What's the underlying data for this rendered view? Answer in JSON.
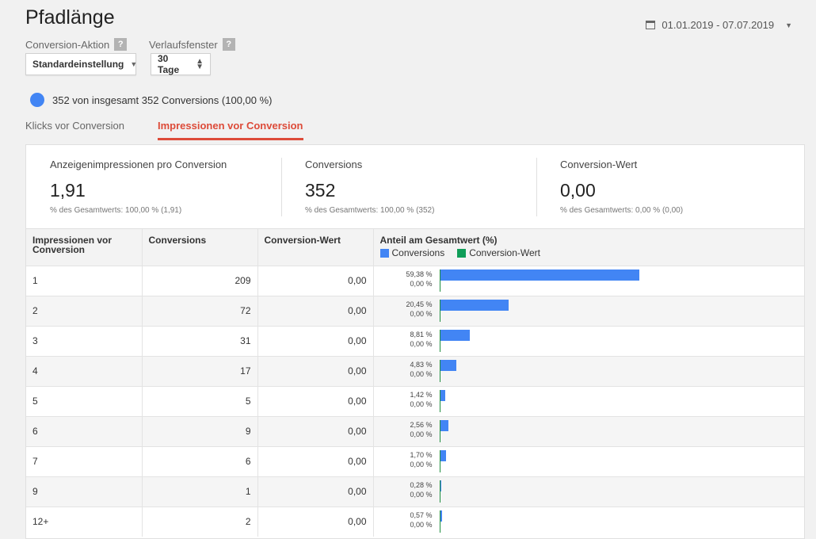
{
  "header": {
    "title": "Pfadlänge",
    "date_range": "01.01.2019 - 07.07.2019"
  },
  "filters": {
    "conversion_action_label": "Conversion-Aktion",
    "conversion_action_value": "Standardeinstellung",
    "lookback_label": "Verlaufsfenster",
    "lookback_value": "30 Tage",
    "help_glyph": "?"
  },
  "segment": {
    "text": "352 von insgesamt 352 Conversions (100,00 %)",
    "color": "#4285f4"
  },
  "tabs": [
    {
      "label": "Klicks vor Conversion",
      "active": false
    },
    {
      "label": "Impressionen vor Conversion",
      "active": true
    }
  ],
  "summary": [
    {
      "label": "Anzeigenimpressionen pro Conversion",
      "value": "1,91",
      "sub": "% des Gesamtwerts: 100,00 % (1,91)"
    },
    {
      "label": "Conversions",
      "value": "352",
      "sub": "% des Gesamtwerts: 100,00 % (352)"
    },
    {
      "label": "Conversion-Wert",
      "value": "0,00",
      "sub": "% des Gesamtwerts: 0,00 % (0,00)"
    }
  ],
  "table": {
    "headers": [
      "Impressionen vor Conversion",
      "Conversions",
      "Conversion-Wert",
      "Anteil am Gesamtwert (%)"
    ],
    "legend": [
      {
        "name": "Conversions",
        "color": "#4285f4"
      },
      {
        "name": "Conversion-Wert",
        "color": "#0f9d58"
      }
    ],
    "rows": [
      {
        "impressions": "1",
        "conversions": "209",
        "value": "0,00",
        "conv_pct_label": "59,38 %",
        "value_pct_label": "0,00 %",
        "conv_pct": 59.38
      },
      {
        "impressions": "2",
        "conversions": "72",
        "value": "0,00",
        "conv_pct_label": "20,45 %",
        "value_pct_label": "0,00 %",
        "conv_pct": 20.45
      },
      {
        "impressions": "3",
        "conversions": "31",
        "value": "0,00",
        "conv_pct_label": "8,81 %",
        "value_pct_label": "0,00 %",
        "conv_pct": 8.81
      },
      {
        "impressions": "4",
        "conversions": "17",
        "value": "0,00",
        "conv_pct_label": "4,83 %",
        "value_pct_label": "0,00 %",
        "conv_pct": 4.83
      },
      {
        "impressions": "5",
        "conversions": "5",
        "value": "0,00",
        "conv_pct_label": "1,42 %",
        "value_pct_label": "0,00 %",
        "conv_pct": 1.42
      },
      {
        "impressions": "6",
        "conversions": "9",
        "value": "0,00",
        "conv_pct_label": "2,56 %",
        "value_pct_label": "0,00 %",
        "conv_pct": 2.56
      },
      {
        "impressions": "7",
        "conversions": "6",
        "value": "0,00",
        "conv_pct_label": "1,70 %",
        "value_pct_label": "0,00 %",
        "conv_pct": 1.7
      },
      {
        "impressions": "9",
        "conversions": "1",
        "value": "0,00",
        "conv_pct_label": "0,28 %",
        "value_pct_label": "0,00 %",
        "conv_pct": 0.28
      },
      {
        "impressions": "12+",
        "conversions": "2",
        "value": "0,00",
        "conv_pct_label": "0,57 %",
        "value_pct_label": "0,00 %",
        "conv_pct": 0.57
      }
    ]
  }
}
